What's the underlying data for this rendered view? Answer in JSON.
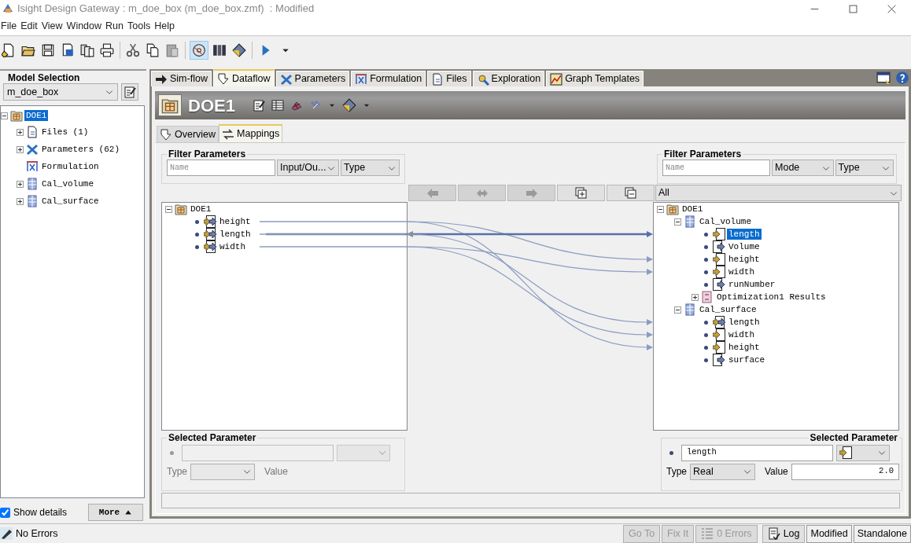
{
  "window": {
    "title": "Isight Design Gateway : m_doe_box (m_doe_box.zmf)  : Modified"
  },
  "menu": [
    "File",
    "Edit",
    "View",
    "Window",
    "Run",
    "Tools",
    "Help"
  ],
  "toolbar": [
    {
      "kind": "new",
      "pressed": false
    },
    {
      "kind": "open",
      "pressed": false
    },
    {
      "kind": "save",
      "pressed": false
    },
    {
      "kind": "export",
      "pressed": false
    },
    {
      "kind": "library",
      "pressed": false
    },
    {
      "kind": "print",
      "pressed": false
    },
    {
      "kind": "separator"
    },
    {
      "kind": "cut",
      "pressed": false
    },
    {
      "kind": "copy",
      "pressed": false
    },
    {
      "kind": "paste",
      "pressed": false
    },
    {
      "kind": "separator"
    },
    {
      "kind": "disc",
      "pressed": true
    },
    {
      "kind": "books",
      "pressed": false
    },
    {
      "kind": "box",
      "pressed": false
    },
    {
      "kind": "separator"
    },
    {
      "kind": "run",
      "pressed": false
    }
  ],
  "model_panel": {
    "title": "Model Selection",
    "model": "m_doe_box",
    "tree": [
      {
        "label": "DOE1",
        "kind": "task",
        "selected": true,
        "expanded": true,
        "children": [
          {
            "label": "Files (1)",
            "kind": "files",
            "selected": false,
            "expanded": false
          },
          {
            "label": "Parameters (62)",
            "kind": "parameters",
            "selected": false,
            "expanded": false
          },
          {
            "label": "Formulation",
            "kind": "formulation",
            "selected": false
          },
          {
            "label": "Cal_volume",
            "kind": "component",
            "selected": false,
            "expanded": false
          },
          {
            "label": "Cal_surface",
            "kind": "component",
            "selected": false,
            "expanded": false
          }
        ]
      }
    ],
    "show_details": {
      "label": "Show details",
      "checked": true
    },
    "more": "More"
  },
  "main_tabs": [
    {
      "label": "Sim-flow",
      "kind": "simflow",
      "selected": false
    },
    {
      "label": "Dataflow",
      "kind": "dataflow",
      "selected": true
    },
    {
      "label": "Parameters",
      "kind": "parameters",
      "selected": false
    },
    {
      "label": "Formulation",
      "kind": "formulation",
      "selected": false
    },
    {
      "label": "Files",
      "kind": "files",
      "selected": false
    },
    {
      "label": "Exploration",
      "kind": "exploration",
      "selected": false
    },
    {
      "label": "Graph Templates",
      "kind": "graph",
      "selected": false
    }
  ],
  "header": {
    "title": "DOE1"
  },
  "sub_tabs": [
    {
      "label": "Overview",
      "kind": "overview",
      "selected": false
    },
    {
      "label": "Mappings",
      "kind": "mappings",
      "selected": true
    }
  ],
  "left_filter": {
    "title": "Filter Parameters",
    "placeholder": "Name",
    "mode": "Input/Ou...",
    "type": "Type"
  },
  "map_buttons": [
    {
      "kind": "map-left",
      "disabled": true
    },
    {
      "kind": "map-both",
      "disabled": true
    },
    {
      "kind": "map-right",
      "disabled": true
    },
    {
      "kind": "expand-all",
      "disabled": false
    },
    {
      "kind": "collapse-all",
      "disabled": false
    }
  ],
  "right_filter": {
    "title": "Filter Parameters",
    "placeholder": "Name",
    "mode": "Mode",
    "type": "Type",
    "scope": "All"
  },
  "left_tree": [
    {
      "label": "DOE1",
      "kind": "task",
      "selected": false,
      "expanded": true,
      "children": [
        {
          "label": "height",
          "kind": "inout",
          "selected": false
        },
        {
          "label": "length",
          "kind": "inout",
          "selected": false
        },
        {
          "label": "width",
          "kind": "inout",
          "selected": false
        }
      ]
    }
  ],
  "right_tree": [
    {
      "label": "DOE1",
      "kind": "task",
      "selected": false,
      "expanded": true,
      "children": [
        {
          "label": "Cal_volume",
          "kind": "component",
          "selected": false,
          "expanded": true,
          "children": [
            {
              "label": "length",
              "kind": "input",
              "selected": true
            },
            {
              "label": "Volume",
              "kind": "output",
              "selected": false
            },
            {
              "label": "height",
              "kind": "input",
              "selected": false
            },
            {
              "label": "width",
              "kind": "input",
              "selected": false
            },
            {
              "label": "runNumber",
              "kind": "output",
              "selected": false
            },
            {
              "label": "Optimization1 Results",
              "kind": "aggregate",
              "selected": false,
              "expanded": false
            }
          ]
        },
        {
          "label": "Cal_surface",
          "kind": "component",
          "selected": false,
          "expanded": true,
          "children": [
            {
              "label": "length",
              "kind": "inout",
              "selected": false
            },
            {
              "label": "width",
              "kind": "input",
              "selected": false
            },
            {
              "label": "height",
              "kind": "input",
              "selected": false
            },
            {
              "label": "surface",
              "kind": "output",
              "selected": false
            }
          ]
        }
      ]
    }
  ],
  "left_selected": {
    "title": "Selected Parameter",
    "disabled": true,
    "type_label": "Type",
    "value_label": "Value"
  },
  "right_selected": {
    "title": "Selected Parameter",
    "disabled": false,
    "name": "length",
    "type": "Real",
    "value": "2.0",
    "type_label": "Type",
    "value_label": "Value"
  },
  "status_bar": {
    "message": "No Errors",
    "buttons": [
      {
        "label": "Go To",
        "kind": "plain",
        "disabled": true
      },
      {
        "label": "Fix It",
        "kind": "plain",
        "disabled": true
      },
      {
        "label": "0 Errors",
        "kind": "errors",
        "disabled": true
      },
      {
        "label": "Log",
        "kind": "log",
        "disabled": false
      }
    ],
    "panes": [
      "Modified",
      "Standalone"
    ]
  }
}
